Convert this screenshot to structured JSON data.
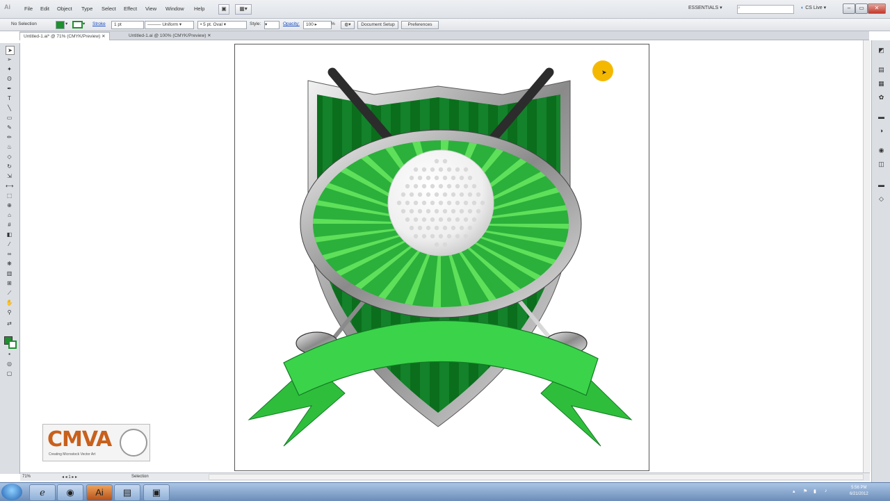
{
  "app": {
    "logo": "Ai"
  },
  "menu": [
    "File",
    "Edit",
    "Object",
    "Type",
    "Select",
    "Effect",
    "View",
    "Window",
    "Help"
  ],
  "toolbar_right": {
    "workspace": "ESSENTIALS",
    "search_placeholder": "",
    "cslive": "CS Live"
  },
  "control": {
    "selection": "No Selection",
    "stroke_label": "Stroke",
    "stroke_weight": "1 pt",
    "stroke_style": "Uniform",
    "brush": "5 pt. Oval",
    "style_label": "Style:",
    "opacity_label": "Opacity:",
    "opacity_value": "100",
    "percent": "%",
    "doc_setup": "Document Setup",
    "preferences": "Preferences"
  },
  "tabs": [
    {
      "label": "Untitled-1.ai* @ 71% (CMYK/Preview)",
      "active": true
    },
    {
      "label": "Untitled-1.ai @ 100% (CMYK/Preview)",
      "active": false
    }
  ],
  "status": {
    "zoom": "71%",
    "page": "1",
    "tool": "Selection"
  },
  "cmva": {
    "name": "CMVA",
    "tagline": "Creating Microstock Vector Art"
  },
  "taskbar": {
    "icons": [
      "ie-icon",
      "folder-icon",
      "firefox-icon",
      "illustrator-icon",
      "notes-icon",
      "media-icon"
    ],
    "time": "5:56 PM",
    "date": "6/21/2012"
  },
  "colors": {
    "fill": "#1f8f2f",
    "accent": "#f5b800",
    "ribbon": "#3bd34a",
    "shield_dark": "#0a6a1a"
  }
}
